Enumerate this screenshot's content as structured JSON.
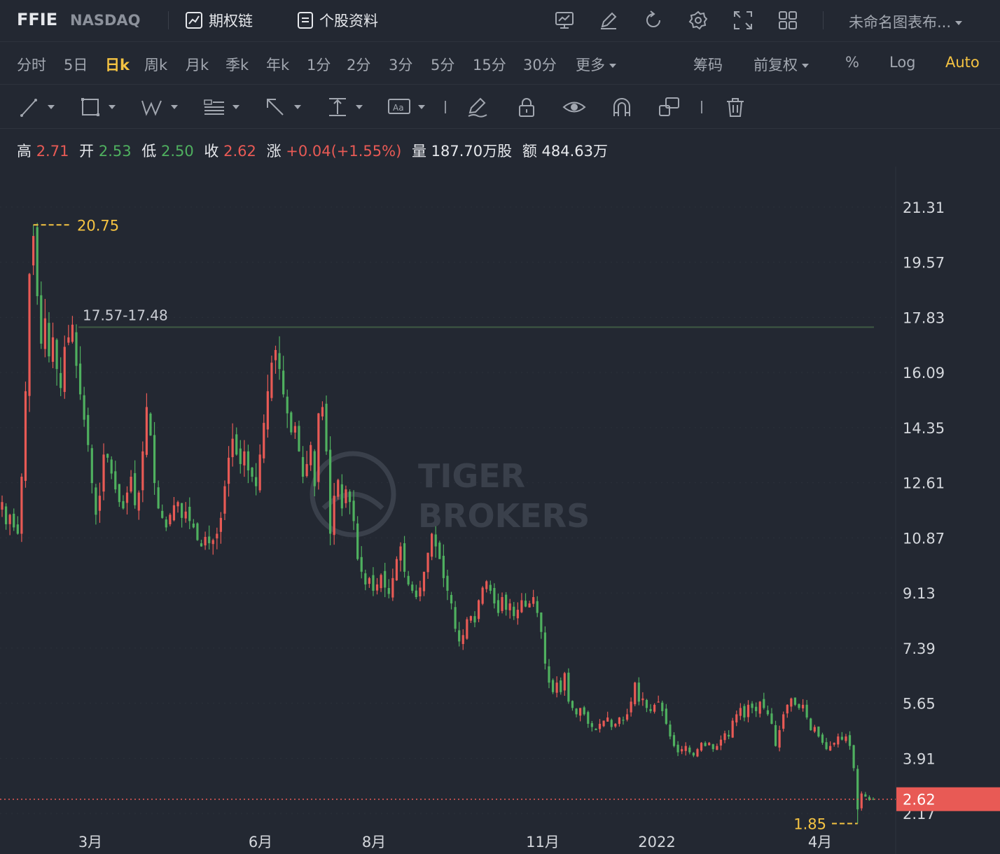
{
  "header": {
    "symbol": "FFIE",
    "exchange": "NASDAQ",
    "options_chain": "期权链",
    "stock_profile": "个股资料",
    "chart_name": "未命名图表布..."
  },
  "icons": [
    "chart-overlay-icon",
    "edit-icon",
    "refresh-icon",
    "settings-icon",
    "fullscreen-icon",
    "layout-grid-icon"
  ],
  "periods": [
    {
      "label": "分时",
      "active": false
    },
    {
      "label": "5日",
      "active": false
    },
    {
      "label": "日k",
      "active": true
    },
    {
      "label": "周k",
      "active": false
    },
    {
      "label": "月k",
      "active": false
    },
    {
      "label": "季k",
      "active": false
    },
    {
      "label": "年k",
      "active": false
    },
    {
      "label": "1分",
      "active": false
    },
    {
      "label": "2分",
      "active": false
    },
    {
      "label": "3分",
      "active": false
    },
    {
      "label": "5分",
      "active": false
    },
    {
      "label": "15分",
      "active": false
    },
    {
      "label": "30分",
      "active": false
    },
    {
      "label": "更多",
      "active": false
    }
  ],
  "options": {
    "chips": "筹码",
    "adjust": "前复权",
    "percent": "%",
    "log": "Log",
    "auto": "Auto"
  },
  "drawing_tools": [
    "trend-line-icon",
    "rectangle-icon",
    "pattern-icon",
    "fib-icon",
    "arrow-icon",
    "range-icon",
    "text-icon",
    "brush-icon",
    "lock-icon",
    "eye-icon",
    "magnet-icon",
    "clone-icon",
    "trash-icon"
  ],
  "ohlc": {
    "high_label": "高",
    "high": "2.71",
    "open_label": "开",
    "open": "2.53",
    "low_label": "低",
    "low": "2.50",
    "close_label": "收",
    "close": "2.62",
    "change_label": "涨",
    "change": "+0.04(+1.55%)",
    "volume_label": "量",
    "volume": "187.70万股",
    "amount_label": "额",
    "amount": "484.63万"
  },
  "colors": {
    "up": "#e85a55",
    "down": "#4fb05f",
    "accent": "#f5c342",
    "background": "#232832"
  },
  "chart_data": {
    "type": "candlestick",
    "x_tick_labels": [
      "3月",
      "6月",
      "8月",
      "11月",
      "2022",
      "4月"
    ],
    "y_tick_labels": [
      "21.31",
      "19.57",
      "17.83",
      "16.09",
      "14.35",
      "12.61",
      "10.87",
      "9.13",
      "7.39",
      "5.65",
      "3.91",
      "2.17"
    ],
    "ylim": [
      0.89,
      22.59
    ],
    "last_price": "2.62",
    "high_marker": "20.75",
    "low_marker": "1.85",
    "range_line_label": "17.57-17.48",
    "range_line_value": 17.52,
    "watermark": [
      "TIGER",
      "BROKERS"
    ],
    "grid": true,
    "series_close": [
      12.0,
      11.3,
      11.6,
      11.2,
      11.0,
      12.8,
      15.5,
      19.2,
      20.4,
      18.5,
      17.0,
      17.8,
      16.6,
      17.2,
      16.2,
      15.6,
      16.9,
      17.2,
      17.6,
      16.3,
      15.4,
      14.6,
      13.8,
      12.6,
      11.6,
      12.2,
      13.5,
      13.4,
      12.9,
      12.4,
      12.0,
      11.8,
      12.3,
      12.8,
      11.9,
      12.3,
      13.6,
      15.0,
      14.1,
      12.6,
      11.8,
      11.5,
      11.2,
      11.6,
      11.9,
      12.0,
      11.5,
      11.7,
      11.4,
      11.2,
      10.8,
      10.6,
      10.9,
      10.7,
      10.8,
      11.0,
      11.5,
      12.5,
      13.4,
      14.0,
      13.5,
      13.2,
      13.6,
      13.0,
      12.8,
      12.5,
      13.5,
      14.5,
      15.5,
      16.4,
      16.8,
      16.2,
      15.4,
      14.8,
      14.2,
      14.4,
      13.6,
      12.8,
      13.2,
      13.8,
      12.5,
      14.8,
      15.0,
      13.6,
      11.0,
      12.2,
      12.7,
      11.8,
      12.4,
      12.0,
      11.4,
      10.2,
      9.8,
      9.4,
      9.6,
      9.2,
      9.4,
      9.7,
      9.3,
      9.1,
      9.6,
      10.2,
      10.6,
      9.8,
      9.4,
      9.2,
      9.0,
      9.3,
      9.8,
      10.4,
      11.0,
      10.6,
      10.2,
      9.6,
      9.2,
      8.8,
      8.0,
      7.6,
      7.8,
      8.3,
      8.4,
      8.2,
      8.9,
      9.3,
      9.5,
      9.2,
      8.8,
      8.5,
      9.0,
      8.6,
      8.8,
      8.4,
      8.6,
      8.9,
      8.7,
      8.8,
      9.0,
      8.5,
      7.9,
      6.9,
      6.3,
      6.0,
      6.3,
      6.0,
      6.6,
      5.7,
      5.5,
      5.3,
      5.5,
      5.3,
      5.0,
      4.9,
      4.8,
      5.0,
      5.1,
      5.2,
      4.9,
      5.0,
      5.2,
      5.1,
      5.3,
      5.7,
      6.3,
      5.7,
      5.8,
      5.5,
      5.4,
      5.6,
      5.7,
      5.4,
      5.0,
      4.6,
      4.3,
      4.1,
      4.2,
      4.3,
      4.1,
      4.0,
      4.2,
      4.4,
      4.3,
      4.4,
      4.2,
      4.3,
      4.5,
      4.7,
      4.6,
      5.1,
      5.3,
      5.5,
      5.2,
      5.6,
      5.5,
      5.4,
      5.7,
      5.5,
      5.3,
      5.0,
      4.3,
      4.8,
      5.3,
      5.6,
      5.8,
      5.6,
      5.5,
      5.6,
      5.2,
      4.8,
      4.9,
      4.6,
      4.4,
      4.2,
      4.3,
      4.4,
      4.6,
      4.5,
      4.6,
      4.3,
      3.6,
      2.3,
      2.8,
      2.7,
      2.6,
      2.62
    ]
  }
}
